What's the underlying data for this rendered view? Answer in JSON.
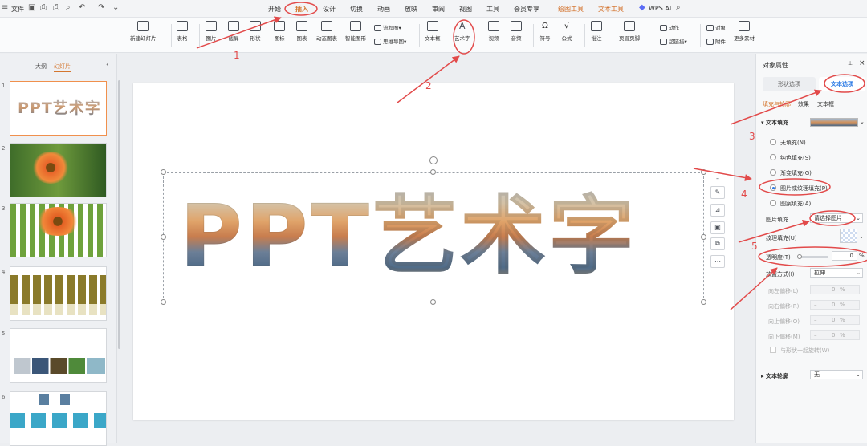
{
  "menubar": {
    "file": "文件",
    "tabs": [
      "开始",
      "插入",
      "设计",
      "切换",
      "动画",
      "放映",
      "审阅",
      "视图",
      "工具",
      "会员专享",
      "绘图工具",
      "文本工具"
    ],
    "wps_ai": "WPS AI"
  },
  "ribbon": {
    "items": [
      "新建幻灯片",
      "表格",
      "图片",
      "截屏",
      "形状",
      "图标",
      "图表",
      "动态图表",
      "智能图形",
      "文本框",
      "艺术字",
      "视频",
      "音频",
      "符号",
      "公式",
      "批注",
      "页眉页脚",
      "附件",
      "更多素材"
    ],
    "stacked": [
      "流程图",
      "思维导图",
      "动作",
      "超链接",
      "对象"
    ]
  },
  "left_panel": {
    "tab_outline": "大纲",
    "tab_slides": "幻灯片",
    "thumbnail_text": "PPT艺术字",
    "numbers": [
      "1",
      "2",
      "3",
      "4",
      "5",
      "6"
    ]
  },
  "slide": {
    "art_text": "PPT艺术字"
  },
  "right_panel": {
    "title": "对象属性",
    "tab_shape": "形状选项",
    "tab_text": "文本选项",
    "subtabs": [
      "填充与轮廓",
      "效果",
      "文本框"
    ],
    "fill_section": "文本填充",
    "fill_options": [
      "无填充(N)",
      "纯色填充(S)",
      "渐变填充(G)",
      "图片或纹理填充(P)",
      "图案填充(A)"
    ],
    "picture_fill_label": "图片填充",
    "picture_fill_value": "请选择图片",
    "texture_fill_label": "纹理填充(U)",
    "transparency_label": "透明度(T)",
    "transparency_value": "0",
    "percent": "%",
    "tile_label": "放置方式(I)",
    "tile_value": "拉伸",
    "offsets": [
      {
        "label": "向左偏移(L)",
        "value": "0"
      },
      {
        "label": "向右偏移(R)",
        "value": "0"
      },
      {
        "label": "向上偏移(O)",
        "value": "0"
      },
      {
        "label": "向下偏移(M)",
        "value": "0"
      }
    ],
    "rotate_with_shape": "与形状一起旋转(W)",
    "outline_section": "文本轮廓",
    "outline_value": "无"
  },
  "annotations": [
    "1",
    "2",
    "3",
    "4",
    "5"
  ],
  "colors": {
    "accent": "#d4762e",
    "annotation": "#e24a4a",
    "active_tab_blue": "#2d7be5"
  }
}
